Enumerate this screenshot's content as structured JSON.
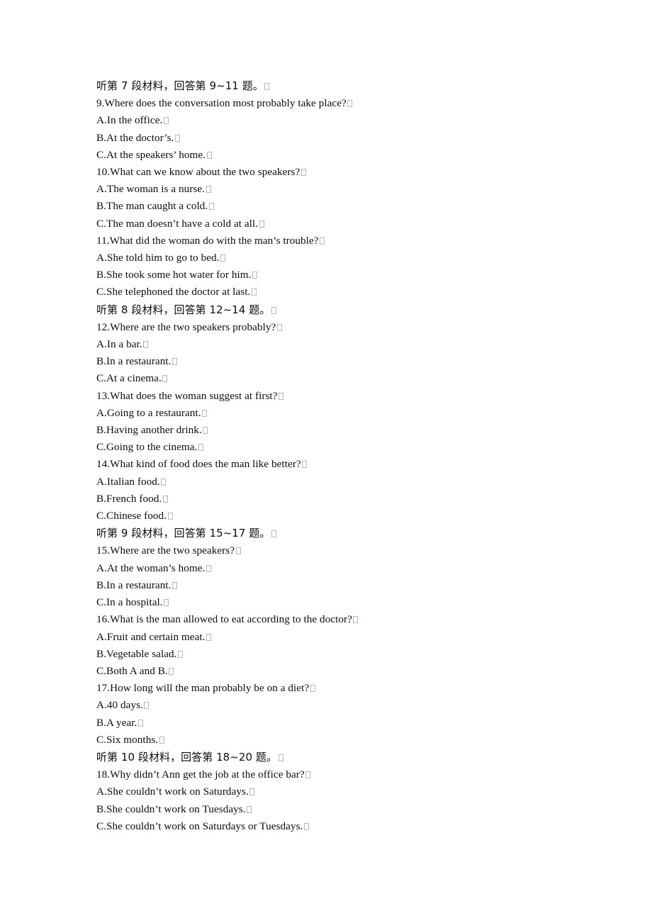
{
  "document": {
    "kind": "listening-comprehension-worksheet",
    "language_mix": "zh-CN + en-US",
    "background_color": "#ffffff",
    "text_color": "#0d0d0d",
    "tofu_box_color": "#b9b4c4",
    "trailing_glyph": "missing-character-box"
  },
  "lines": [
    {
      "id": "l01",
      "type": "section-header",
      "cjk": true,
      "text": "听第 7 段材料，回答第 9~11 题。",
      "tofu": true
    },
    {
      "id": "l02",
      "type": "question",
      "cjk": false,
      "text": "9.Where does the conversation most probably take place?",
      "tofu": true
    },
    {
      "id": "l03",
      "type": "choice",
      "cjk": false,
      "text": "A.In the office.",
      "tofu": true
    },
    {
      "id": "l04",
      "type": "choice",
      "cjk": false,
      "text": "B.At the doctor’s.",
      "tofu": true
    },
    {
      "id": "l05",
      "type": "choice",
      "cjk": false,
      "text": "C.At the speakers’ home.",
      "tofu": true
    },
    {
      "id": "l06",
      "type": "question",
      "cjk": false,
      "text": "10.What can we know about the two speakers?",
      "tofu": true
    },
    {
      "id": "l07",
      "type": "choice",
      "cjk": false,
      "text": "A.The woman is a nurse.",
      "tofu": true
    },
    {
      "id": "l08",
      "type": "choice",
      "cjk": false,
      "text": "B.The man caught a cold.",
      "tofu": true
    },
    {
      "id": "l09",
      "type": "choice",
      "cjk": false,
      "text": "C.The man doesn’t have a cold at all.",
      "tofu": true
    },
    {
      "id": "l10",
      "type": "question",
      "cjk": false,
      "text": "11.What did the woman do with the man’s trouble?",
      "tofu": true
    },
    {
      "id": "l11",
      "type": "choice",
      "cjk": false,
      "text": "A.She told him to go to bed.",
      "tofu": true
    },
    {
      "id": "l12",
      "type": "choice",
      "cjk": false,
      "text": "B.She took some hot water for him.",
      "tofu": true
    },
    {
      "id": "l13",
      "type": "choice",
      "cjk": false,
      "text": "C.She telephoned the doctor at last.",
      "tofu": true
    },
    {
      "id": "l14",
      "type": "section-header",
      "cjk": true,
      "text": "听第 8 段材料，回答第 12~14 题。",
      "tofu": true
    },
    {
      "id": "l15",
      "type": "question",
      "cjk": false,
      "text": "12.Where are the two speakers probably?",
      "tofu": true
    },
    {
      "id": "l16",
      "type": "choice",
      "cjk": false,
      "text": "A.In a bar.",
      "tofu": true
    },
    {
      "id": "l17",
      "type": "choice",
      "cjk": false,
      "text": "B.In a restaurant.",
      "tofu": true
    },
    {
      "id": "l18",
      "type": "choice",
      "cjk": false,
      "text": "C.At a cinema.",
      "tofu": true
    },
    {
      "id": "l19",
      "type": "question",
      "cjk": false,
      "text": "13.What does the woman suggest at first?",
      "tofu": true
    },
    {
      "id": "l20",
      "type": "choice",
      "cjk": false,
      "text": "A.Going to a restaurant.",
      "tofu": true
    },
    {
      "id": "l21",
      "type": "choice",
      "cjk": false,
      "text": "B.Having another drink.",
      "tofu": true
    },
    {
      "id": "l22",
      "type": "choice",
      "cjk": false,
      "text": "C.Going to the cinema.",
      "tofu": true
    },
    {
      "id": "l23",
      "type": "question",
      "cjk": false,
      "text": "14.What kind of food does the man like better?",
      "tofu": true
    },
    {
      "id": "l24",
      "type": "choice",
      "cjk": false,
      "text": "A.Italian food.",
      "tofu": true
    },
    {
      "id": "l25",
      "type": "choice",
      "cjk": false,
      "text": "B.French food.",
      "tofu": true
    },
    {
      "id": "l26",
      "type": "choice",
      "cjk": false,
      "text": "C.Chinese food.",
      "tofu": true
    },
    {
      "id": "l27",
      "type": "section-header",
      "cjk": true,
      "text": "听第 9 段材料，回答第 15~17 题。",
      "tofu": true
    },
    {
      "id": "l28",
      "type": "question",
      "cjk": false,
      "text": "15.Where are the two speakers?",
      "tofu": true
    },
    {
      "id": "l29",
      "type": "choice",
      "cjk": false,
      "text": "A.At the woman’s home.",
      "tofu": true
    },
    {
      "id": "l30",
      "type": "choice",
      "cjk": false,
      "text": "B.In a restaurant.",
      "tofu": true
    },
    {
      "id": "l31",
      "type": "choice",
      "cjk": false,
      "text": "C.In a hospital.",
      "tofu": true
    },
    {
      "id": "l32",
      "type": "question",
      "cjk": false,
      "text": "16.What is the man allowed to eat according to the doctor?",
      "tofu": true
    },
    {
      "id": "l33",
      "type": "choice",
      "cjk": false,
      "text": "A.Fruit and certain meat.",
      "tofu": true
    },
    {
      "id": "l34",
      "type": "choice",
      "cjk": false,
      "text": "B.Vegetable salad.",
      "tofu": true
    },
    {
      "id": "l35",
      "type": "choice",
      "cjk": false,
      "text": "C.Both A and B.",
      "tofu": true
    },
    {
      "id": "l36",
      "type": "question",
      "cjk": false,
      "text": "17.How long will the man probably be on a diet?",
      "tofu": true
    },
    {
      "id": "l37",
      "type": "choice",
      "cjk": false,
      "text": "A.40 days.",
      "tofu": true
    },
    {
      "id": "l38",
      "type": "choice",
      "cjk": false,
      "text": "B.A year.",
      "tofu": true
    },
    {
      "id": "l39",
      "type": "choice",
      "cjk": false,
      "text": "C.Six months.",
      "tofu": true
    },
    {
      "id": "l40",
      "type": "section-header",
      "cjk": true,
      "text": "听第 10 段材料，回答第 18~20 题。",
      "tofu": true
    },
    {
      "id": "l41",
      "type": "question",
      "cjk": false,
      "text": "18.Why didn’t Ann get the job at the office bar?",
      "tofu": true
    },
    {
      "id": "l42",
      "type": "choice",
      "cjk": false,
      "text": "A.She couldn’t work on Saturdays.",
      "tofu": true
    },
    {
      "id": "l43",
      "type": "choice",
      "cjk": false,
      "text": "B.She couldn’t work on Tuesdays.",
      "tofu": true
    },
    {
      "id": "l44",
      "type": "choice",
      "cjk": false,
      "text": "C.She couldn’t work on Saturdays or Tuesdays.",
      "tofu": true
    }
  ]
}
